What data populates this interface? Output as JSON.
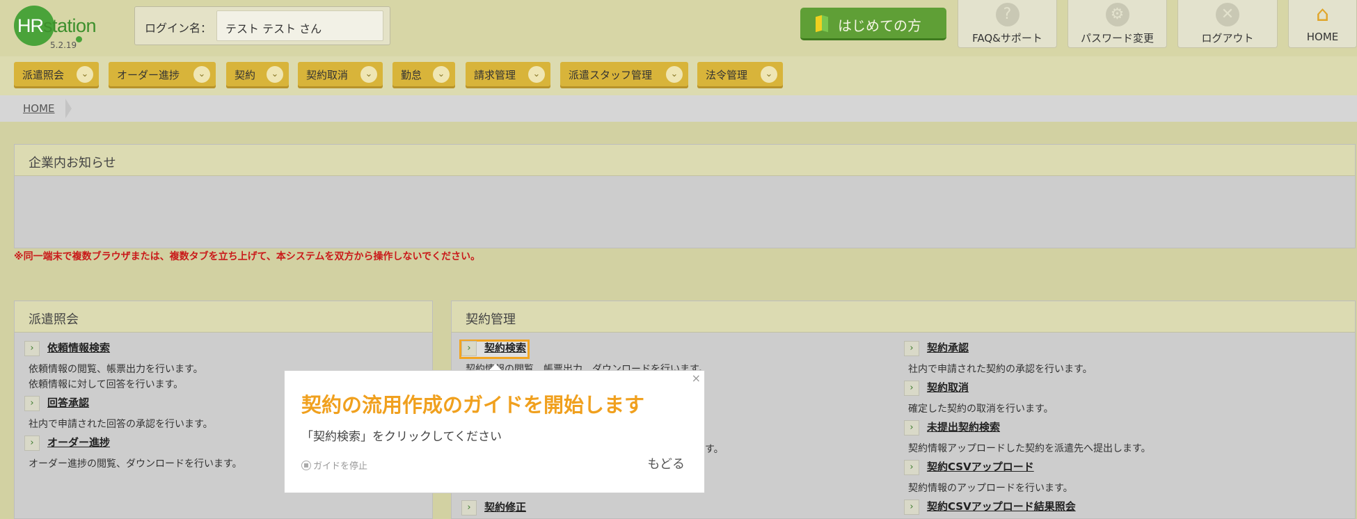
{
  "header": {
    "logo_hr": "HR",
    "logo_station": "station",
    "version": "5.2.19",
    "login_label": "ログイン名：",
    "login_name": "テスト テスト さん",
    "beginner_button": "はじめての方",
    "buttons": [
      {
        "label": "FAQ&サポート",
        "icon": "question-icon"
      },
      {
        "label": "パスワード変更",
        "icon": "gear-icon"
      },
      {
        "label": "ログアウト",
        "icon": "close-circle-icon"
      },
      {
        "label": "HOME",
        "icon": "home-icon"
      }
    ]
  },
  "nav": {
    "menus": [
      "派遣照会",
      "オーダー進捗",
      "契約",
      "契約取消",
      "勤怠",
      "請求管理",
      "派遣スタッフ管理",
      "法令管理"
    ]
  },
  "breadcrumb": {
    "home": "HOME"
  },
  "notice": {
    "title": "企業内お知らせ",
    "warning": "※同一端末で複数ブラウザまたは、複数タブを立ち上げて、本システムを双方から操作しないでください。"
  },
  "haken_panel": {
    "title": "派遣照会",
    "items": [
      {
        "link": "依頼情報検索",
        "desc1": "依頼情報の閲覧、帳票出力を行います。",
        "desc2": "依頼情報に対して回答を行います。"
      },
      {
        "link": "回答承認",
        "desc1": "社内で申請された回答の承認を行います。"
      },
      {
        "link": "オーダー進捗",
        "desc1": "オーダー進捗の閲覧、ダウンロードを行います。"
      }
    ]
  },
  "keiyaku_panel": {
    "title": "契約管理",
    "left": {
      "search_link": "契約検索",
      "search_desc": "契約情報の閲覧、帳票出力、ダウンロードを行います。",
      "partial_desc": "す。",
      "modify_link": "契約修正"
    },
    "right": [
      {
        "link": "契約承認",
        "desc": "社内で申請された契約の承認を行います。"
      },
      {
        "link": "契約取消",
        "desc": "確定した契約の取消を行います。"
      },
      {
        "link": "未提出契約検索",
        "desc": "契約情報アップロードした契約を派遣先へ提出します。"
      },
      {
        "link": "契約CSVアップロード",
        "desc": "契約情報のアップロードを行います。"
      },
      {
        "link": "契約CSVアップロード結果照会",
        "desc": ""
      }
    ]
  },
  "guide": {
    "title": "契約の流用作成のガイドを開始します",
    "message": "「契約検索」をクリックしてください",
    "stop": "ガイドを停止",
    "back": "もどる",
    "close": "×"
  }
}
